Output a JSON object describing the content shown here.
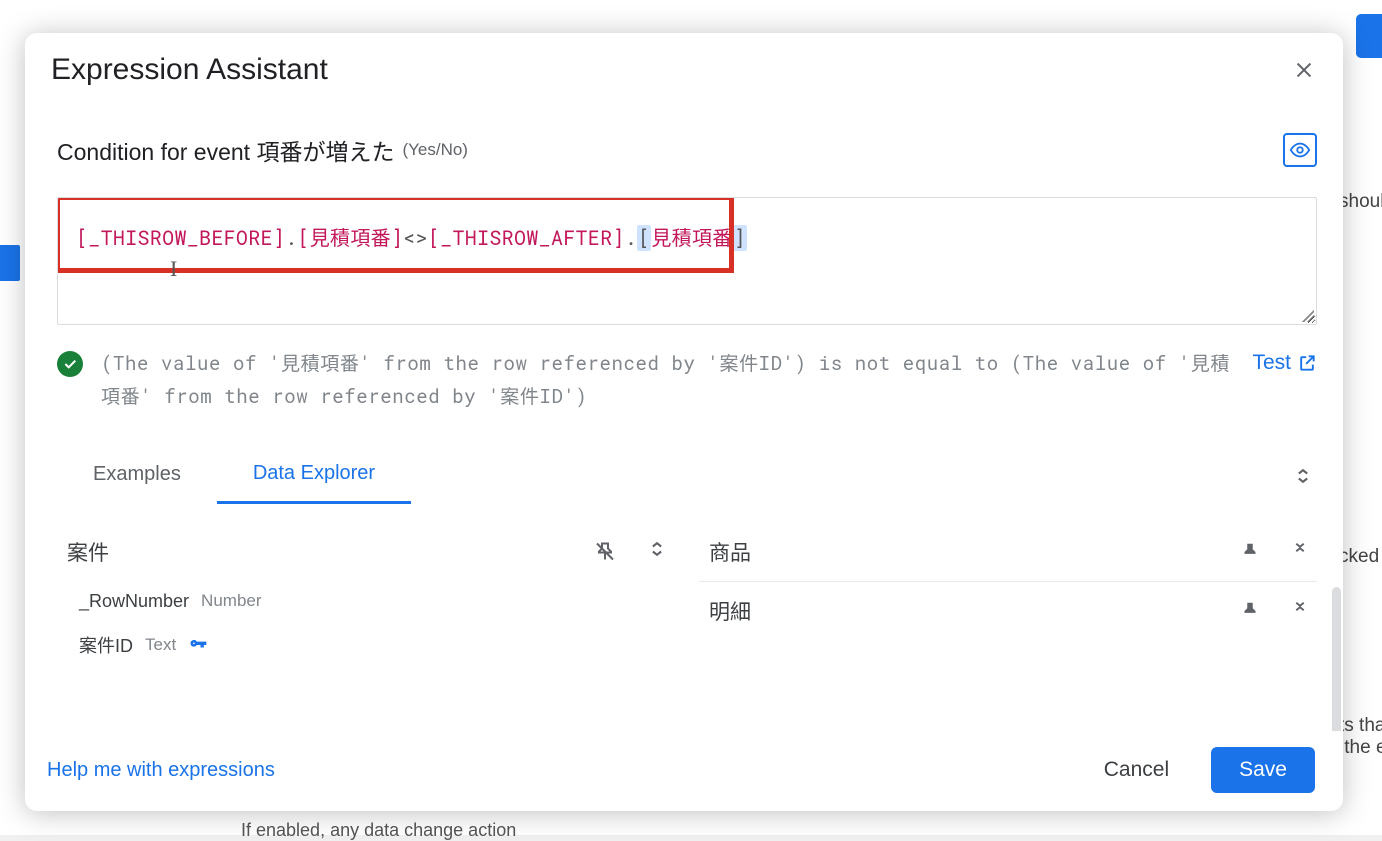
{
  "background": {
    "text1": "shoul",
    "text2": "cked",
    "text3": "ts tha\n the e",
    "text4": "If enabled, any data change action"
  },
  "modal": {
    "title": "Expression Assistant",
    "condition_label": "Condition for event 項番が増えた",
    "condition_type": "(Yes/No)",
    "expression": {
      "t1": "[_THISROW_BEFORE]",
      "dot1": ".",
      "t2": "[見積項番]",
      "op": "<>",
      "t3": "[_THISROW_AFTER]",
      "dot2": ".",
      "sel_open": "[",
      "sel_mid": "見積項番",
      "sel_close": "]"
    },
    "validation_text": "(The value of '見積項番' from the row referenced by '案件ID') is not equal to (The value of '見積項番' from the row referenced by '案件ID')",
    "test_label": "Test",
    "tabs": {
      "examples": "Examples",
      "data_explorer": "Data Explorer"
    },
    "explorer": {
      "left_table": "案件",
      "left_cols": [
        {
          "name": "_RowNumber",
          "type": "Number"
        },
        {
          "name": "案件ID",
          "type": "Text",
          "key": true
        }
      ],
      "right_tables": [
        "商品",
        "明細"
      ]
    },
    "footer": {
      "help": "Help me with expressions",
      "cancel": "Cancel",
      "save": "Save"
    }
  }
}
